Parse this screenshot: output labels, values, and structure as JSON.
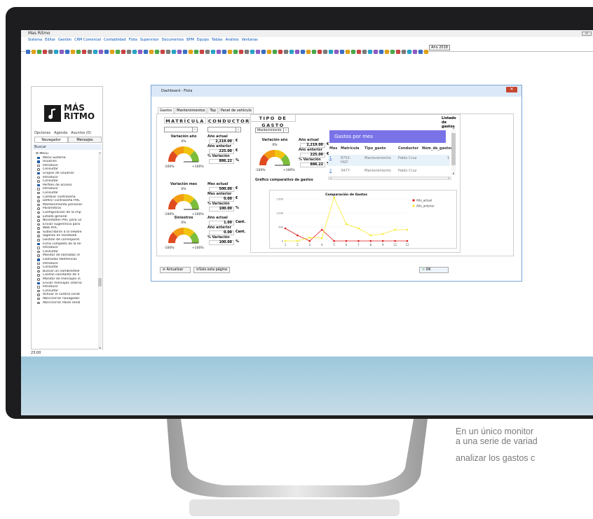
{
  "app": {
    "window_title": "Mas Ritmo",
    "menu": [
      "Sistema",
      "Editar",
      "Gestión",
      "CRM Comercial",
      "Contabilidad",
      "Flota",
      "Supervisor",
      "Documentos",
      "BPM",
      "Equipo",
      "Tablas",
      "Análisis",
      "Ventanas"
    ],
    "year_label": "Año 2018",
    "time": "23:00"
  },
  "sidebar": {
    "logo_text_1": "MÁS",
    "logo_text_2": "RITMO",
    "tabs_top": [
      "Opciones",
      "Agenda",
      "Asuntos (0)"
    ],
    "tabs": [
      "Navegador",
      "Mensajes"
    ],
    "buscar": "Buscar",
    "tree": [
      {
        "t": "Menú",
        "i": "root"
      },
      {
        "t": "Menú Sistema",
        "i": "folder"
      },
      {
        "t": "Usuarios",
        "i": "folder"
      },
      {
        "t": "Introducir",
        "i": "doc"
      },
      {
        "t": "Consultar",
        "i": "circ"
      },
      {
        "t": "Grupos de usuarios",
        "i": "folder"
      },
      {
        "t": "Introducir",
        "i": "doc"
      },
      {
        "t": "Consultar",
        "i": "circ"
      },
      {
        "t": "Perfiles de acceso",
        "i": "folder"
      },
      {
        "t": "Introducir",
        "i": "doc"
      },
      {
        "t": "Consultar",
        "i": "circ"
      },
      {
        "t": "Cambiar contraseña",
        "i": "circ"
      },
      {
        "t": "Definir contraseña PHC",
        "i": "circ"
      },
      {
        "t": "Mantenimiento personal",
        "i": "circ"
      },
      {
        "t": "Parámetros",
        "i": "circ"
      },
      {
        "t": "Configuración de la imp",
        "i": "circ"
      },
      {
        "t": "Estado general",
        "i": "circ"
      },
      {
        "t": "Novedades PHC para us",
        "i": "circ"
      },
      {
        "t": "Enviar sugerencia para",
        "i": "circ"
      },
      {
        "t": "Web PHC",
        "i": "circ"
      },
      {
        "t": "Subscribirse a la newsle",
        "i": "circ"
      },
      {
        "t": "Síganos en Facebook",
        "i": "circ"
      },
      {
        "t": "Gestión de correspond",
        "i": "circ"
      },
      {
        "t": "Ficha completa de la en",
        "i": "folder"
      },
      {
        "t": "Introducir",
        "i": "doc"
      },
      {
        "t": "Consultar",
        "i": "circ"
      },
      {
        "t": "Monitor de llamadas re",
        "i": "circ"
      },
      {
        "t": "Llamadas telefónicas",
        "i": "folder"
      },
      {
        "t": "Introducir",
        "i": "doc"
      },
      {
        "t": "Consultar",
        "i": "circ"
      },
      {
        "t": "Buscar un nombre/telé",
        "i": "circ"
      },
      {
        "t": "Control constante de ll",
        "i": "circ"
      },
      {
        "t": "Monitor de mensajes in",
        "i": "circ"
      },
      {
        "t": "Enviar mensajes interno",
        "i": "folder"
      },
      {
        "t": "Introducir",
        "i": "doc"
      },
      {
        "t": "Consultar",
        "i": "circ"
      },
      {
        "t": "Activar el control const",
        "i": "circ"
      },
      {
        "t": "Abrir/cerrar navegador",
        "i": "circ"
      },
      {
        "t": "Abrir/cerrar Panel rendi",
        "i": "circ"
      }
    ]
  },
  "dialog": {
    "title": "Dashboard - Flota",
    "tabs": [
      "Gastos",
      "Mantenimientos",
      "Top",
      "Panel de vehículo"
    ],
    "col_matricula": "MATRÍCULA",
    "col_conductor": "CONDUCTOR",
    "col_tipo": "TIPO DE GASTO",
    "tipo_select": "Mantenimiento",
    "gauge_min": "-100%",
    "gauge_max": "+100%",
    "gauge_zero": "0%",
    "gauges": [
      {
        "title": "Variación año",
        "l1": "Año actual",
        "v1": "2,219.00",
        "u1": "€",
        "l2": "Año anterior",
        "v2": "225.00",
        "u2": "€",
        "l3": "% Variación",
        "v3": "886.22",
        "u3": "%"
      },
      {
        "title": "Variación mes",
        "l1": "Mes actual",
        "v1": "500.00",
        "u1": "€",
        "l2": "Mes anterior",
        "v2": "0.00",
        "u2": "€",
        "l3": "% Variación",
        "v3": "100.00",
        "u3": "%"
      },
      {
        "title": "Siniestros",
        "l1": "Año actual",
        "v1": "1.00",
        "u1": "Cant.",
        "l2": "Año anterior",
        "v2": "0.00",
        "u2": "Cant.",
        "l3": "% Variación",
        "v3": "100.00",
        "u3": "%"
      }
    ],
    "tipo_gauge": {
      "title": "Variación año",
      "l1": "Año actual",
      "v1": "2,219.00",
      "u1": "€",
      "l2": "Año anterior",
      "v2": "225.00",
      "u2": "€",
      "l3": "% Variación",
      "v3": "886.22",
      "u3": "%"
    },
    "listado_title": "Listado de gastos",
    "gastos_banner": "Gastos por mes",
    "table_headers": [
      "Mes",
      "Matrícula",
      "Tipo_gasto",
      "Conductor",
      "Núm_de_gastos"
    ],
    "table_rows": [
      {
        "mes": "1",
        "mat1": "8703-",
        "mat2": "HGY",
        "tipo": "Mantenimiento",
        "cond": "Pablo Cruz",
        "num": "1"
      },
      {
        "mes": "2",
        "mat1": "3477-",
        "mat2": "",
        "tipo": "Mantenimiento",
        "cond": "Pablo Cruz",
        "num": ""
      }
    ],
    "grafico_title": "Gráfico comparativo de gastos",
    "btn_actualizar": "Actualizar",
    "btn_solo": "Solo esta página",
    "btn_ok": "OK"
  },
  "chart_data": [
    {
      "type": "gauge",
      "title": "Variación año",
      "range": [
        -100,
        100
      ],
      "bands": [
        "#e04a1f",
        "#f39c12",
        "#f1c40f",
        "#7cbd3b"
      ],
      "value_percent": 886.22
    },
    {
      "type": "line",
      "title": "Comparación de Gastos",
      "categories": [
        "1",
        "2",
        "3",
        "4",
        "5",
        "6",
        "7",
        "8",
        "9",
        "11",
        "12"
      ],
      "ylim": [
        0,
        1500
      ],
      "yticks": [
        "0",
        "500",
        "1.000",
        "1.500"
      ],
      "series": [
        {
          "name": "Año_actual",
          "color": "#e01818",
          "values": [
            450,
            200,
            0,
            400,
            0,
            0,
            0,
            0,
            0,
            0,
            0
          ]
        },
        {
          "name": "Año_anterior",
          "color": "#f5ea2a",
          "values": [
            0,
            0,
            120,
            100,
            1550,
            600,
            450,
            200,
            250,
            400,
            400
          ]
        }
      ]
    }
  ],
  "caption": {
    "line1": "En un único monitor",
    "line2": "a una serie de variad",
    "line3": "analizar los gastos c"
  }
}
